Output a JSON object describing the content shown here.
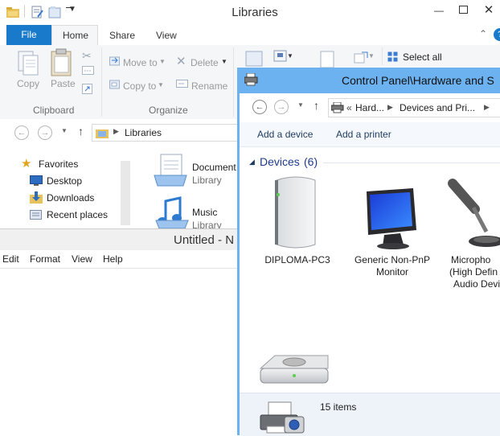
{
  "explorer": {
    "title": "Libraries",
    "tabs": {
      "file": "File",
      "home": "Home",
      "share": "Share",
      "view": "View"
    },
    "ribbon": {
      "copy": "Copy",
      "paste": "Paste",
      "clipboard_label": "Clipboard",
      "move_to": "Move to",
      "copy_to": "Copy to",
      "delete": "Delete",
      "rename": "Rename",
      "organize_label": "Organize",
      "select_all": "Select all"
    },
    "address": {
      "location": "Libraries"
    },
    "nav": {
      "favorites": "Favorites",
      "desktop": "Desktop",
      "downloads": "Downloads",
      "recent": "Recent places"
    },
    "items": [
      {
        "name": "Document",
        "type": "Library"
      },
      {
        "name": "Music",
        "type": "Library"
      }
    ]
  },
  "notepad": {
    "title": "Untitled - N",
    "menu": {
      "edit": "Edit",
      "format": "Format",
      "view": "View",
      "help": "Help"
    }
  },
  "cpanel": {
    "title": "Control Panel\\Hardware and S",
    "breadcrumb": {
      "prefix": "«",
      "item1": "Hard...",
      "item2": "Devices and Pri..."
    },
    "commands": {
      "add_device": "Add a device",
      "add_printer": "Add a printer"
    },
    "section": {
      "name": "Devices",
      "count": "(6)"
    },
    "devices": [
      {
        "line1": "DIPLOMA-PC3",
        "line2": "",
        "line3": ""
      },
      {
        "line1": "Generic Non-PnP",
        "line2": "Monitor",
        "line3": ""
      },
      {
        "line1": "Micropho",
        "line2": "(High Defin",
        "line3": "Audio Devi"
      }
    ],
    "details": {
      "count": "15 items"
    }
  },
  "colors": {
    "accent": "#1979ca",
    "window_border": "#6cb2f0",
    "link": "#1e3a5f"
  }
}
